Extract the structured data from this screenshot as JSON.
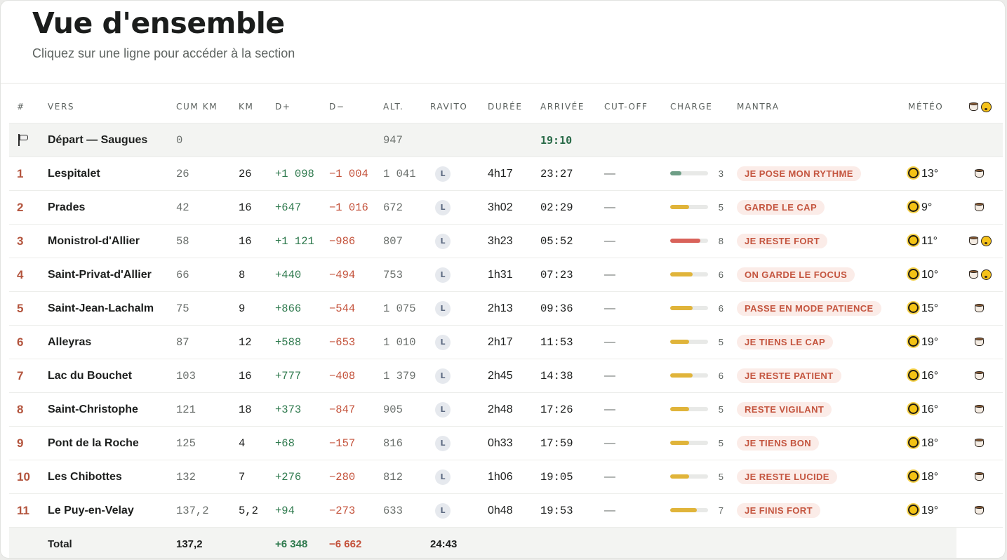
{
  "header": {
    "title": "Vue d'ensemble",
    "subtitle": "Cliquez sur une ligne pour accéder à la section"
  },
  "columns": [
    "#",
    "VERS",
    "CUM KM",
    "KM",
    "D+",
    "D−",
    "ALT.",
    "RAVITO",
    "DURÉE",
    "ARRIVÉE",
    "CUT-OFF",
    "CHARGE",
    "MANTRA",
    "MÉTÉO"
  ],
  "emoji_column_icons": [
    "coffee-icon",
    "sleepy-face-icon"
  ],
  "start": {
    "icon": "flag-icon",
    "name": "Départ — Saugues",
    "cum_km": "0",
    "alt": "947",
    "arrival": "19:10"
  },
  "rows": [
    {
      "num": "1",
      "name": "Lespitalet",
      "cum_km": "26",
      "km": "26",
      "dplus": "+1 098",
      "dminus": "−1 004",
      "alt": "1 041",
      "ravito": "L",
      "duree": "4h17",
      "arrivee": "23:27",
      "cutoff": "—",
      "charge": 3,
      "mantra": "JE POSE MON RYTHME",
      "temp": "13°",
      "sleepy": false
    },
    {
      "num": "2",
      "name": "Prades",
      "cum_km": "42",
      "km": "16",
      "dplus": "+647",
      "dminus": "−1 016",
      "alt": "672",
      "ravito": "L",
      "duree": "3h02",
      "arrivee": "02:29",
      "cutoff": "—",
      "charge": 5,
      "mantra": "GARDE LE CAP",
      "temp": "9°",
      "sleepy": false
    },
    {
      "num": "3",
      "name": "Monistrol-d'Allier",
      "cum_km": "58",
      "km": "16",
      "dplus": "+1 121",
      "dminus": "−986",
      "alt": "807",
      "ravito": "L",
      "duree": "3h23",
      "arrivee": "05:52",
      "cutoff": "—",
      "charge": 8,
      "mantra": "JE RESTE FORT",
      "temp": "11°",
      "sleepy": true
    },
    {
      "num": "4",
      "name": "Saint-Privat-d'Allier",
      "cum_km": "66",
      "km": "8",
      "dplus": "+440",
      "dminus": "−494",
      "alt": "753",
      "ravito": "L",
      "duree": "1h31",
      "arrivee": "07:23",
      "cutoff": "—",
      "charge": 6,
      "mantra": "ON GARDE LE FOCUS",
      "temp": "10°",
      "sleepy": true
    },
    {
      "num": "5",
      "name": "Saint-Jean-Lachalm",
      "cum_km": "75",
      "km": "9",
      "dplus": "+866",
      "dminus": "−544",
      "alt": "1 075",
      "ravito": "L",
      "duree": "2h13",
      "arrivee": "09:36",
      "cutoff": "—",
      "charge": 6,
      "mantra": "PASSE EN MODE PATIENCE",
      "temp": "15°",
      "sleepy": false
    },
    {
      "num": "6",
      "name": "Alleyras",
      "cum_km": "87",
      "km": "12",
      "dplus": "+588",
      "dminus": "−653",
      "alt": "1 010",
      "ravito": "L",
      "duree": "2h17",
      "arrivee": "11:53",
      "cutoff": "—",
      "charge": 5,
      "mantra": "JE TIENS LE CAP",
      "temp": "19°",
      "sleepy": false
    },
    {
      "num": "7",
      "name": "Lac du Bouchet",
      "cum_km": "103",
      "km": "16",
      "dplus": "+777",
      "dminus": "−408",
      "alt": "1 379",
      "ravito": "L",
      "duree": "2h45",
      "arrivee": "14:38",
      "cutoff": "—",
      "charge": 6,
      "mantra": "JE RESTE PATIENT",
      "temp": "16°",
      "sleepy": false
    },
    {
      "num": "8",
      "name": "Saint-Christophe",
      "cum_km": "121",
      "km": "18",
      "dplus": "+373",
      "dminus": "−847",
      "alt": "905",
      "ravito": "L",
      "duree": "2h48",
      "arrivee": "17:26",
      "cutoff": "—",
      "charge": 5,
      "mantra": "RESTE VIGILANT",
      "temp": "16°",
      "sleepy": false
    },
    {
      "num": "9",
      "name": "Pont de la Roche",
      "cum_km": "125",
      "km": "4",
      "dplus": "+68",
      "dminus": "−157",
      "alt": "816",
      "ravito": "L",
      "duree": "0h33",
      "arrivee": "17:59",
      "cutoff": "—",
      "charge": 5,
      "mantra": "JE TIENS BON",
      "temp": "18°",
      "sleepy": false
    },
    {
      "num": "10",
      "name": "Les Chibottes",
      "cum_km": "132",
      "km": "7",
      "dplus": "+276",
      "dminus": "−280",
      "alt": "812",
      "ravito": "L",
      "duree": "1h06",
      "arrivee": "19:05",
      "cutoff": "—",
      "charge": 5,
      "mantra": "JE RESTE LUCIDE",
      "temp": "18°",
      "sleepy": false
    },
    {
      "num": "11",
      "name": "Le Puy-en-Velay",
      "cum_km": "137,2",
      "km": "5,2",
      "dplus": "+94",
      "dminus": "−273",
      "alt": "633",
      "ravito": "L",
      "duree": "0h48",
      "arrivee": "19:53",
      "cutoff": "—",
      "charge": 7,
      "mantra": "JE FINIS FORT",
      "temp": "19°",
      "sleepy": false
    }
  ],
  "total": {
    "label": "Total",
    "cum_km": "137,2",
    "dplus": "+6 348",
    "dminus": "−6 662",
    "duree": "24:43"
  },
  "colors": {
    "charge_low": "#6e9e86",
    "charge_mid": "#e0b43a",
    "charge_high": "#d9625a"
  }
}
